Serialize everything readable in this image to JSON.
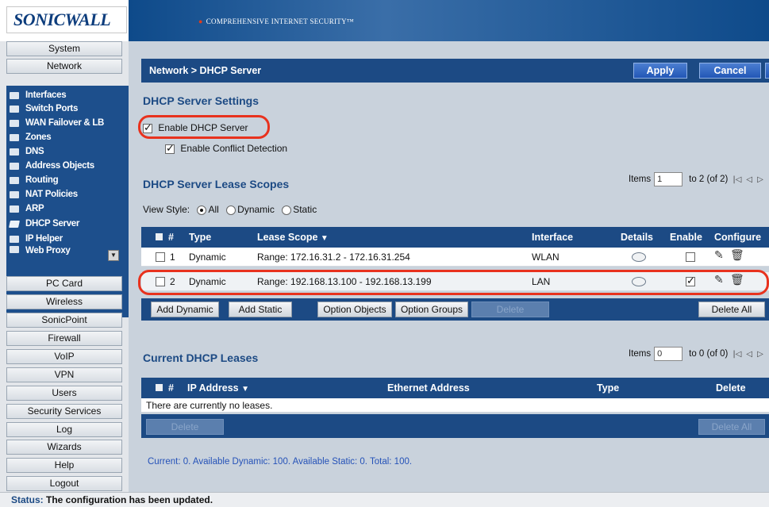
{
  "header": {
    "logo": "SONICWALL",
    "tagline": "COMPREHENSIVE INTERNET SECURITY™"
  },
  "sidebar": {
    "top_items": [
      "System",
      "Network"
    ],
    "network_items": [
      {
        "label": "Interfaces",
        "icon": "folder-icon"
      },
      {
        "label": "Switch Ports",
        "icon": "folder-icon"
      },
      {
        "label": "WAN Failover & LB",
        "icon": "folder-icon"
      },
      {
        "label": "Zones",
        "icon": "folder-icon"
      },
      {
        "label": "DNS",
        "icon": "folder-icon"
      },
      {
        "label": "Address Objects",
        "icon": "folder-icon"
      },
      {
        "label": "Routing",
        "icon": "folder-icon"
      },
      {
        "label": "NAT Policies",
        "icon": "folder-icon"
      },
      {
        "label": "ARP",
        "icon": "folder-icon"
      },
      {
        "label": "DHCP Server",
        "icon": "folder-open-icon"
      },
      {
        "label": "IP Helper",
        "icon": "folder-icon"
      },
      {
        "label": "Web Proxy",
        "icon": "folder-icon"
      }
    ],
    "bottom_items": [
      "PC Card",
      "Wireless",
      "SonicPoint",
      "Firewall",
      "VoIP",
      "VPN",
      "Users",
      "Security Services",
      "Log",
      "Wizards",
      "Help",
      "Logout"
    ]
  },
  "main": {
    "title": "Network > DHCP Server",
    "apply_label": "Apply",
    "cancel_label": "Cancel",
    "help_label": "?",
    "settings": {
      "heading": "DHCP Server Settings",
      "enable_dhcp": "Enable DHCP Server",
      "enable_conflict": "Enable Conflict Detection"
    },
    "scopes": {
      "heading": "DHCP Server Lease Scopes",
      "items_label": "Items",
      "items_value": "1",
      "range_text": "to 2 (of 2)",
      "view_style_label": "View Style:",
      "view_options": [
        "All",
        "Dynamic",
        "Static"
      ],
      "columns": [
        "#",
        "Type",
        "Lease Scope",
        "Interface",
        "Details",
        "Enable",
        "Configure"
      ],
      "rows": [
        {
          "num": "1",
          "type": "Dynamic",
          "scope": "Range: 172.16.31.2 - 172.16.31.254",
          "interface": "WLAN",
          "enabled": false
        },
        {
          "num": "2",
          "type": "Dynamic",
          "scope": "Range: 192.168.13.100 - 192.168.13.199",
          "interface": "LAN",
          "enabled": true
        }
      ],
      "buttons": [
        "Add Dynamic",
        "Add Static",
        "Option Objects",
        "Option Groups",
        "Delete",
        "Delete All"
      ]
    },
    "leases": {
      "heading": "Current DHCP Leases",
      "items_label": "Items",
      "items_value": "0",
      "range_text": "to 0 (of 0)",
      "columns": [
        "#",
        "IP Address",
        "Ethernet Address",
        "Type",
        "Delete"
      ],
      "empty_text": "There are currently no leases.",
      "delete_label": "Delete",
      "delete_all_label": "Delete All"
    },
    "summary": "Current: 0. Available Dynamic: 100. Available Static: 0. Total: 100."
  },
  "status": {
    "label": "Status:",
    "text": "The configuration has been updated."
  }
}
